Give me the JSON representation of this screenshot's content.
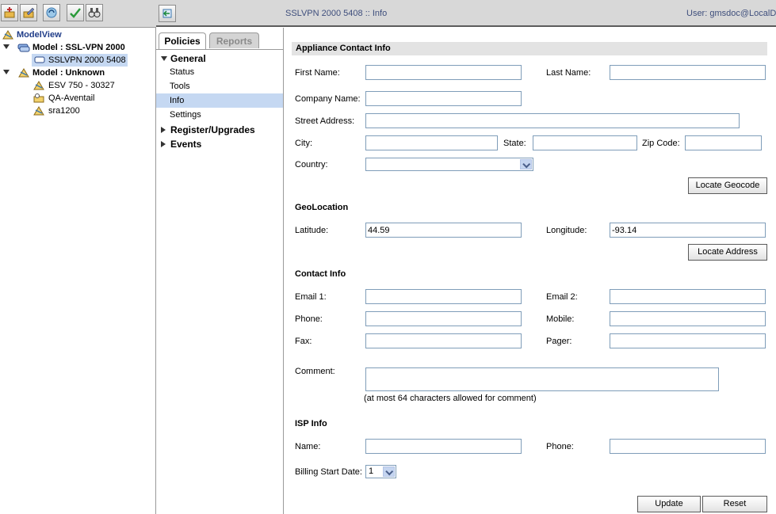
{
  "toolbar": {
    "icons": [
      "add-icon",
      "edit-icon",
      "refresh-icon",
      "discover-icon",
      "binoculars-icon"
    ]
  },
  "header": {
    "title": "SSLVPN 2000 5408 :: Info",
    "user": "User: gmsdoc@LocalDo"
  },
  "tree": {
    "root": "ModelView",
    "groups": [
      {
        "label": "Model : SSL-VPN 2000",
        "items": [
          "SSLVPN 2000  5408"
        ]
      },
      {
        "label": "Model : Unknown",
        "items": [
          "ESV 750 - 30327",
          "QA-Aventail",
          "sra1200"
        ]
      }
    ]
  },
  "tabs": {
    "policies": "Policies",
    "reports": "Reports"
  },
  "nav": {
    "general": "General",
    "items": [
      "Status",
      "Tools",
      "Info",
      "Settings"
    ],
    "register": "Register/Upgrades",
    "events": "Events"
  },
  "form": {
    "appliance_section": "Appliance Contact Info",
    "first_name_label": "First Name:",
    "last_name_label": "Last Name:",
    "company_label": "Company Name:",
    "street_label": "Street Address:",
    "city_label": "City:",
    "state_label": "State:",
    "zip_label": "Zip Code:",
    "country_label": "Country:",
    "country_value": "",
    "locate_geocode": "Locate Geocode",
    "geo_section": "GeoLocation",
    "latitude_label": "Latitude:",
    "latitude_value": "44.59",
    "longitude_label": "Longitude:",
    "longitude_value": "-93.14",
    "locate_address": "Locate Address",
    "contact_section": "Contact Info",
    "email1_label": "Email 1:",
    "email2_label": "Email 2:",
    "phone_label": "Phone:",
    "mobile_label": "Mobile:",
    "fax_label": "Fax:",
    "pager_label": "Pager:",
    "comment_label": "Comment:",
    "comment_hint": "(at most 64 characters allowed for comment)",
    "isp_section": "ISP Info",
    "isp_name_label": "Name:",
    "isp_phone_label": "Phone:",
    "billing_label": "Billing Start Date:",
    "billing_value": "1",
    "update": "Update",
    "reset": "Reset"
  }
}
